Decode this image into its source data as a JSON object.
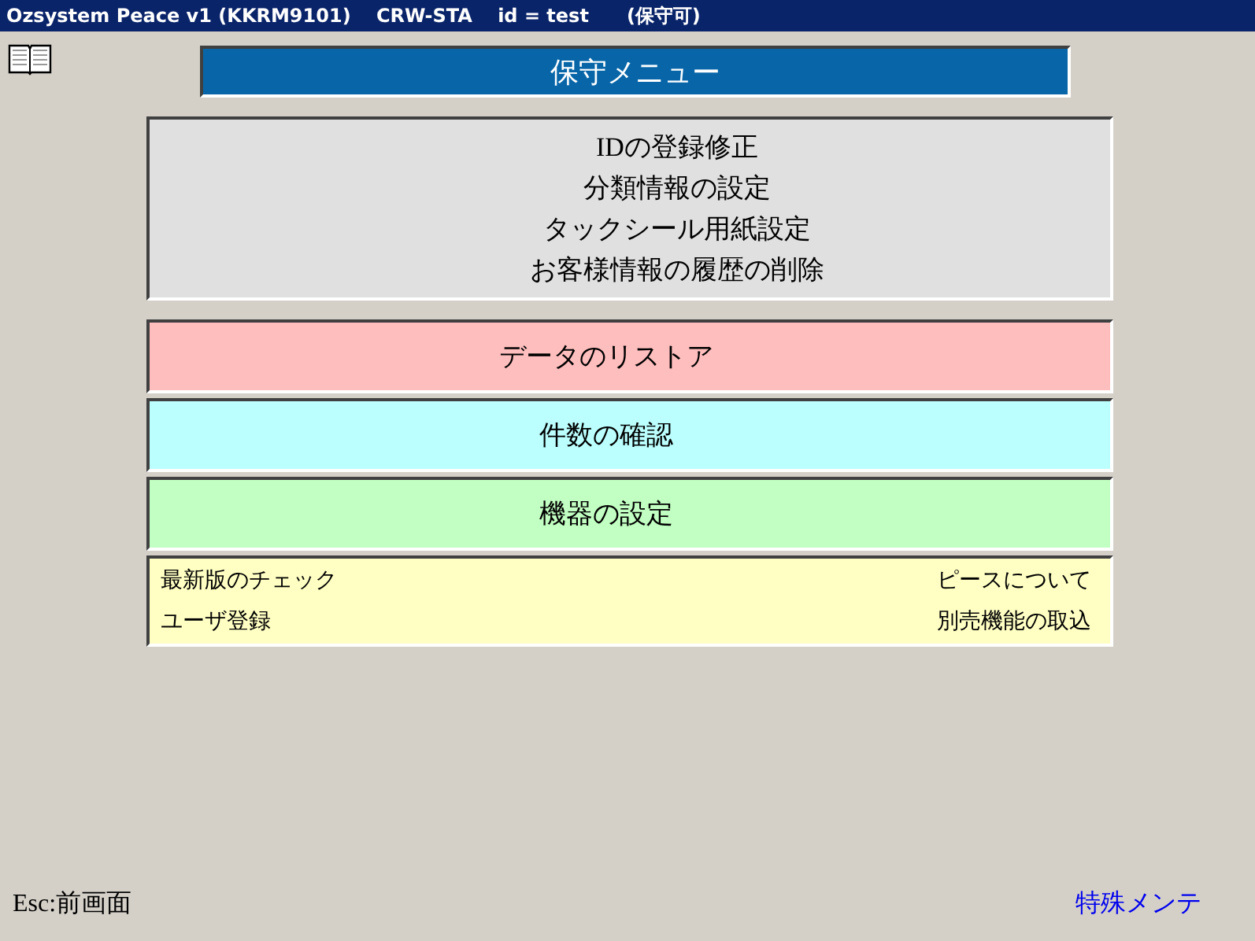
{
  "window": {
    "title": "Ozsystem Peace v1 (KKRM9101)　 CRW-STA　 id = test　　(保守可)"
  },
  "header": {
    "title": "保守メニュー"
  },
  "panels": [
    {
      "kind": "stack",
      "color": "#e0e0e0",
      "items": [
        "IDの登録修正",
        "分類情報の設定",
        "タックシール用紙設定",
        "お客様情報の履歴の削除"
      ]
    },
    {
      "kind": "single",
      "color": "#ffbebe",
      "items": [
        "データのリストア"
      ]
    },
    {
      "kind": "single",
      "color": "#bcffff",
      "items": [
        "件数の確認"
      ]
    },
    {
      "kind": "single",
      "color": "#c2ffc2",
      "items": [
        "機器の設定"
      ]
    },
    {
      "kind": "grid",
      "color": "#ffffc4",
      "items": [
        "最新版のチェック",
        "ピースについて",
        "ユーザ登録",
        "別売機能の取込"
      ]
    }
  ],
  "footer": {
    "back_hint": "Esc:前画面",
    "special_link": "特殊メンテ"
  }
}
